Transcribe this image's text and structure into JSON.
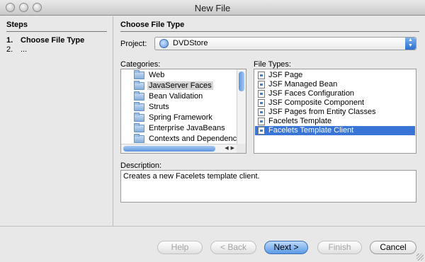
{
  "window": {
    "title": "New File"
  },
  "steps": {
    "heading": "Steps",
    "items": [
      {
        "num": "1.",
        "label": "Choose File Type"
      },
      {
        "num": "2.",
        "label": "..."
      }
    ]
  },
  "main": {
    "heading": "Choose File Type",
    "project_label": "Project:",
    "project_value": "DVDStore",
    "categories_label": "Categories:",
    "categories": [
      "Web",
      "JavaServer Faces",
      "Bean Validation",
      "Struts",
      "Spring Framework",
      "Enterprise JavaBeans",
      "Contexts and Dependency"
    ],
    "selected_category": "JavaServer Faces",
    "file_types_label": "File Types:",
    "file_types": [
      "JSF Page",
      "JSF Managed Bean",
      "JSF Faces Configuration",
      "JSF Composite Component",
      "JSF Pages from Entity Classes",
      "Facelets Template",
      "Facelets Template Client"
    ],
    "selected_file_type": "Facelets Template Client",
    "description_label": "Description:",
    "description_text": "Creates a new Facelets template client."
  },
  "buttons": {
    "help": "Help",
    "back": "< Back",
    "next": "Next >",
    "finish": "Finish",
    "cancel": "Cancel"
  },
  "colors": {
    "selection": "#3875d7",
    "default_button": "#5c9ae6"
  }
}
